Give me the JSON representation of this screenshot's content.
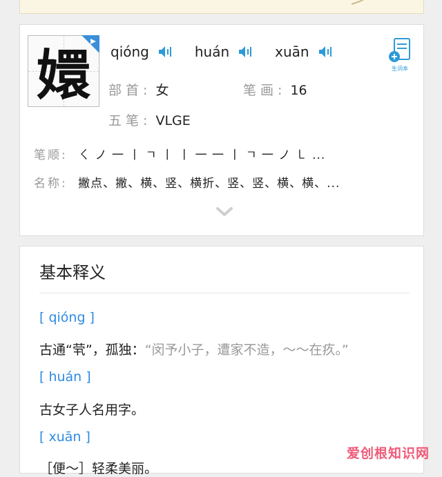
{
  "header": {
    "pinyin": [
      {
        "text": "qióng",
        "icon": "speaker-icon"
      },
      {
        "text": "huán",
        "icon": "speaker-icon"
      },
      {
        "text": "xuān",
        "icon": "speaker-icon"
      }
    ],
    "character": "嬛",
    "notebook_label": "生词本"
  },
  "info": {
    "radical_label": "部首:",
    "radical_value": "女",
    "strokes_label": "笔画:",
    "strokes_value": "16",
    "wubi_label": "五笔:",
    "wubi_value": "VLGE"
  },
  "stroke_order": {
    "label": "笔顺:",
    "value": "ㄑ ノ 一 丨 ㄱ 丨 丨 一 一 丨 ㄱ 一 ノ ㇄ ..."
  },
  "stroke_names": {
    "label": "名称:",
    "value": "撇点、撇、横、竖、横折、竖、竖、横、横、..."
  },
  "meaning": {
    "title": "基本释义",
    "entries": [
      {
        "pinyin": "[ qióng ]",
        "text": "古通“茕”，孤独：",
        "quote": "“闵予小子，遭家不造，～～在疚。”"
      },
      {
        "pinyin": "[ huán ]",
        "text": "古女子人名用字。"
      },
      {
        "pinyin": "[ xuān ]",
        "text": "［便～］轻柔美丽。"
      }
    ]
  },
  "watermark": "爱创根知识网",
  "colors": {
    "accent": "#2d8be0",
    "speaker": "#2d9ad8",
    "watermark": "#f05a78"
  }
}
